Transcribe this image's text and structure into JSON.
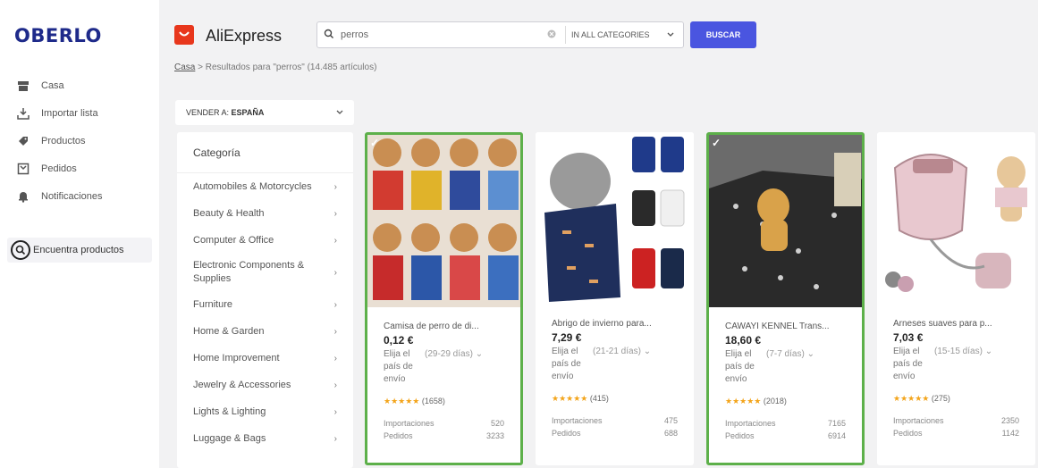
{
  "sidebar": {
    "logo": "OBERLO",
    "items": [
      {
        "label": "Casa",
        "icon": "home-icon"
      },
      {
        "label": "Importar lista",
        "icon": "download-icon"
      },
      {
        "label": "Productos",
        "icon": "tag-icon"
      },
      {
        "label": "Pedidos",
        "icon": "orders-icon"
      },
      {
        "label": "Notificaciones",
        "icon": "bell-icon"
      }
    ],
    "find_label": "Encuentra productos"
  },
  "header": {
    "store_name": "AliExpress",
    "search_value": "perros",
    "category_select": "IN ALL CATEGORIES",
    "search_button": "BUSCAR"
  },
  "breadcrumb": {
    "home": "Casa",
    "separator": ">",
    "results": "Resultados para \"perros\" (14.485 artículos)"
  },
  "ship_to": {
    "label": "VENDER A:",
    "value": "ESPAÑA"
  },
  "categories": {
    "heading": "Categoría",
    "items": [
      "Automobiles & Motorcycles",
      "Beauty & Health",
      "Computer & Office",
      "Electronic Components & Supplies",
      "Furniture",
      "Home & Garden",
      "Home Improvement",
      "Jewelry & Accessories",
      "Lights & Lighting",
      "Luggage & Bags"
    ]
  },
  "products": [
    {
      "title": "Camisa de perro de di...",
      "price": "0,12 €",
      "ship_label": "Elija el país de envío",
      "ship_days": "(29-29 días)",
      "rating_count": "(1658)",
      "imports_label": "Importaciones",
      "imports": "520",
      "orders_label": "Pedidos",
      "orders": "3233",
      "selected": true
    },
    {
      "title": "Abrigo de invierno para...",
      "price": "7,29 €",
      "ship_label": "Elija el país de envío",
      "ship_days": "(21-21 días)",
      "rating_count": "(415)",
      "imports_label": "Importaciones",
      "imports": "475",
      "orders_label": "Pedidos",
      "orders": "688",
      "selected": false
    },
    {
      "title": "CAWAYI KENNEL Trans...",
      "price": "18,60 €",
      "ship_label": "Elija el país de envío",
      "ship_days": "(7-7 días)",
      "rating_count": "(2018)",
      "imports_label": "Importaciones",
      "imports": "7165",
      "orders_label": "Pedidos",
      "orders": "6914",
      "selected": true
    },
    {
      "title": "Arneses suaves para p...",
      "price": "7,03 €",
      "ship_label": "Elija el país de envío",
      "ship_days": "(15-15 días)",
      "rating_count": "(275)",
      "imports_label": "Importaciones",
      "imports": "2350",
      "orders_label": "Pedidos",
      "orders": "1142",
      "selected": false
    }
  ],
  "colors": {
    "brand": "#1e2a8a",
    "button": "#4a55e0",
    "selected_border": "#5db04a",
    "star": "#f3a41a"
  }
}
